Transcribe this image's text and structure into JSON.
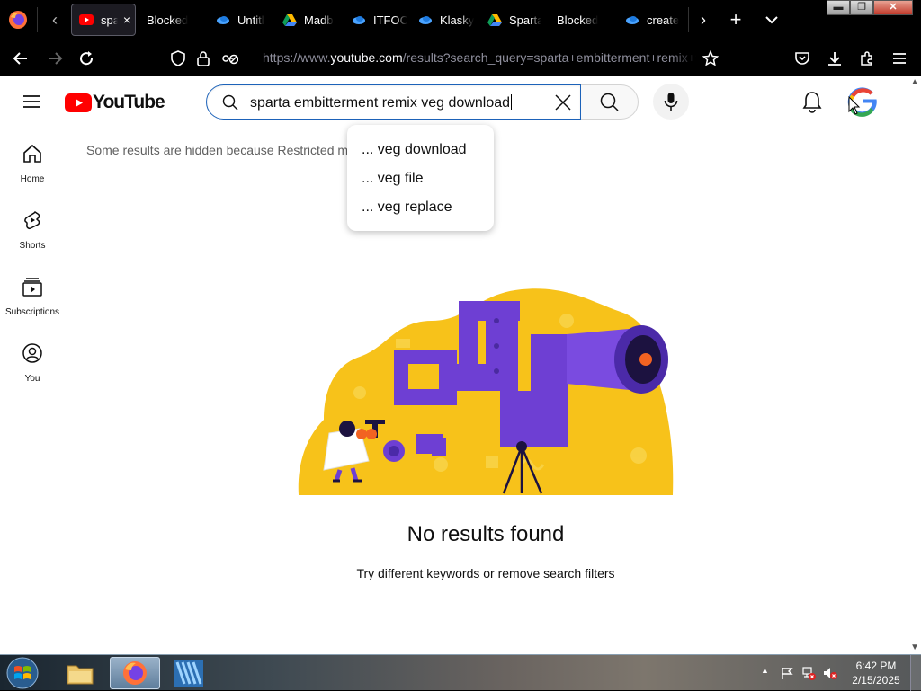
{
  "browser": {
    "tabs": [
      {
        "label": "spa",
        "favicon": "youtube-icon",
        "active": true
      },
      {
        "label": "Blocked",
        "favicon": "none"
      },
      {
        "label": "Untitl",
        "favicon": "cloud-icon"
      },
      {
        "label": "Madb",
        "favicon": "google-drive-icon"
      },
      {
        "label": "ITFOC",
        "favicon": "cloud-icon"
      },
      {
        "label": "Klasky",
        "favicon": "cloud-icon"
      },
      {
        "label": "Sparta",
        "favicon": "google-drive-icon"
      },
      {
        "label": "Blocked",
        "favicon": "none"
      },
      {
        "label": "create",
        "favicon": "cloud-icon"
      }
    ],
    "tab_close_glyph": "×",
    "new_tab_glyph": "+",
    "window_buttons": {
      "minimize": "▬",
      "restore": "❐",
      "close": "✕"
    },
    "url": {
      "prefix": "https://www.",
      "domain": "youtube.com",
      "path": "/results?search_query=sparta+embitterment+remix+veg+download"
    }
  },
  "youtube": {
    "logo_text": "YouTube",
    "search": {
      "value": "sparta embitterment remix veg download",
      "suggestions": [
        "... veg download",
        "... veg file",
        "... veg replace"
      ]
    },
    "guide": [
      {
        "label": "Home",
        "icon": "home-icon"
      },
      {
        "label": "Shorts",
        "icon": "shorts-icon"
      },
      {
        "label": "Subscriptions",
        "icon": "subscriptions-icon"
      },
      {
        "label": "You",
        "icon": "you-icon"
      }
    ],
    "notice": "Some results are hidden because Restricted m",
    "empty_title": "No results found",
    "empty_subtitle": "Try different keywords or remove search filters",
    "colors": {
      "brand_red": "#ff0000",
      "search_border": "#1c62b9",
      "illustration_yellow": "#f7c21a",
      "illustration_purple": "#6e3fd3",
      "illustration_orange": "#f26322"
    }
  },
  "taskbar": {
    "apps": [
      {
        "name": "windows-explorer",
        "icon": "folder-icon"
      },
      {
        "name": "firefox",
        "icon": "firefox-icon",
        "active": true
      },
      {
        "name": "kinemaster",
        "icon": "kinemaster-icon"
      }
    ],
    "tray_arrow": "▲",
    "clock": {
      "time": "6:42 PM",
      "date": "2/15/2025"
    }
  }
}
